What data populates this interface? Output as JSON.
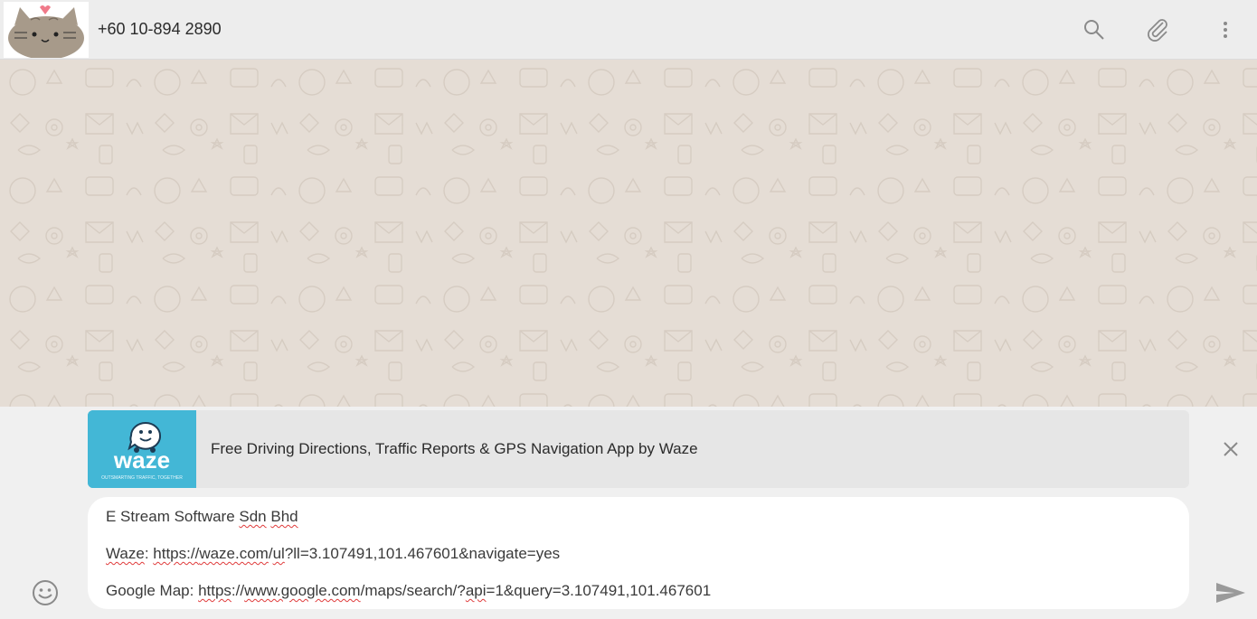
{
  "header": {
    "contact_name": "+60 10-894 2890",
    "icons": [
      "search-icon",
      "attach-icon",
      "menu-icon"
    ]
  },
  "preview": {
    "title": "Free Driving Directions, Traffic Reports & GPS Navigation App by Waze",
    "thumb_brand": "waze",
    "thumb_tagline": "OUTSMARTING TRAFFIC, TOGETHER"
  },
  "composer": {
    "line1": {
      "company_prefix": "E Stream Software ",
      "w1": "Sdn",
      "sp": " ",
      "w2": "Bhd"
    },
    "line2": {
      "label": "Waze",
      "colon": ": ",
      "url_a": "https://",
      "url_b": "waze.com",
      "url_c": "/",
      "url_d": "ul",
      "url_e": "?ll=3.107491,101.467601&navigate=yes"
    },
    "line3": {
      "label": "Google Map: ",
      "url_a": "https",
      "url_b": "://",
      "url_c": "www.google.com",
      "url_d": "/maps/search/?",
      "url_e": "api",
      "url_f": "=1&query=3.107491,101.467601"
    }
  },
  "colors": {
    "header_bg": "#ededed",
    "chat_bg": "#e5ddd5",
    "footer_bg": "#f0f0f0",
    "waze_blue": "#43b7d6"
  }
}
